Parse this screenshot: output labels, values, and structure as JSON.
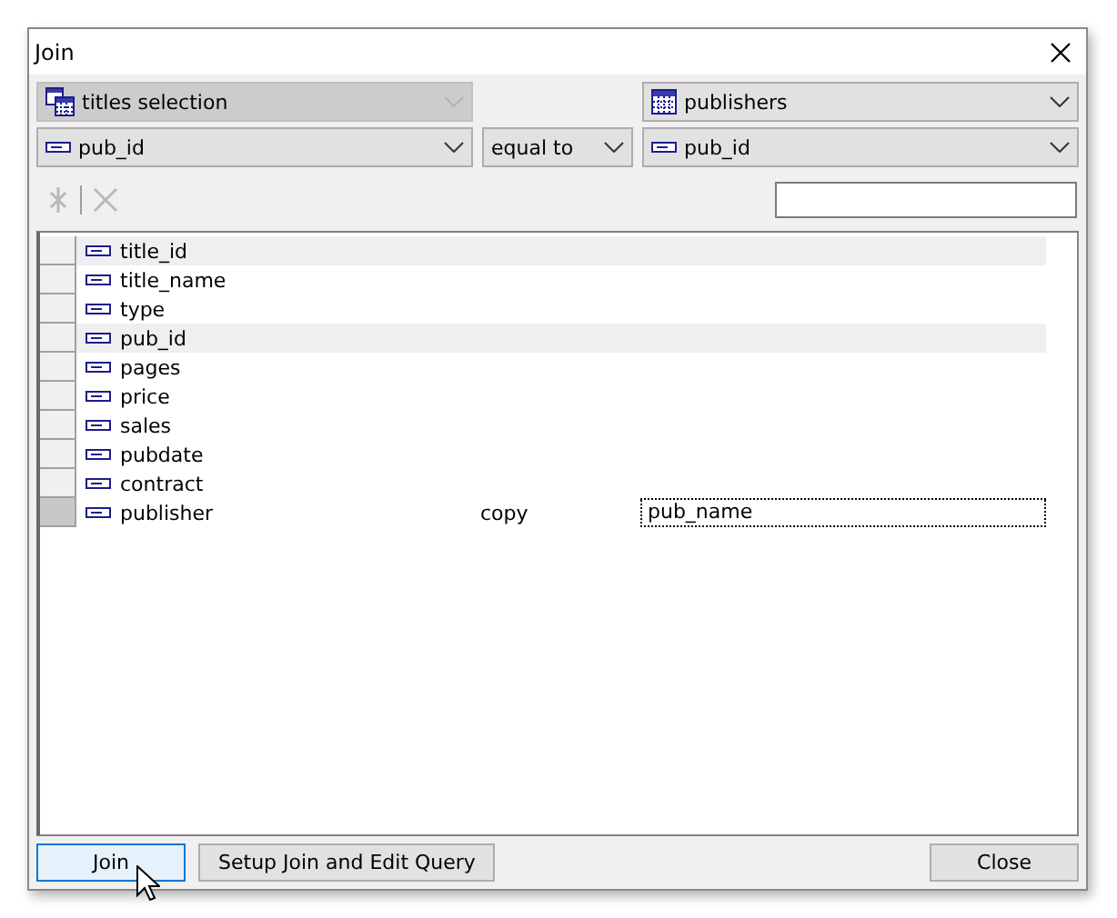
{
  "window": {
    "title": "Join"
  },
  "source_combo": {
    "label": "titles selection",
    "kind": "query",
    "disabled": true
  },
  "target_combo": {
    "label": "publishers",
    "kind": "table",
    "disabled": false
  },
  "left_field": {
    "label": "pub_id",
    "kind": "field",
    "disabled": false
  },
  "operator": {
    "label": "equal to",
    "disabled": false
  },
  "right_field": {
    "label": "pub_id",
    "kind": "field",
    "disabled": false
  },
  "toolbar": [
    {
      "kind": "add",
      "disabled": true
    },
    {
      "kind": "delete",
      "disabled": true
    }
  ],
  "rows": [
    {
      "name": "title_id",
      "highlighted": true,
      "current": false
    },
    {
      "name": "title_name",
      "highlighted": false,
      "current": false
    },
    {
      "name": "type",
      "highlighted": false,
      "current": false
    },
    {
      "name": "pub_id",
      "highlighted": true,
      "current": false
    },
    {
      "name": "pages",
      "highlighted": false,
      "current": false
    },
    {
      "name": "price",
      "highlighted": false,
      "current": false
    },
    {
      "name": "sales",
      "highlighted": false,
      "current": false
    },
    {
      "name": "pubdate",
      "highlighted": false,
      "current": false
    },
    {
      "name": "contract",
      "highlighted": false,
      "current": false
    },
    {
      "name": "publisher",
      "highlighted": false,
      "current": true,
      "action": "copy",
      "target": "pub_name"
    }
  ],
  "buttons": [
    {
      "label": "Join",
      "default": true,
      "hovered": true
    },
    {
      "label": "Setup Join and Edit Query",
      "default": false,
      "hovered": false
    },
    {
      "label": "Close",
      "default": false,
      "hovered": false
    }
  ]
}
